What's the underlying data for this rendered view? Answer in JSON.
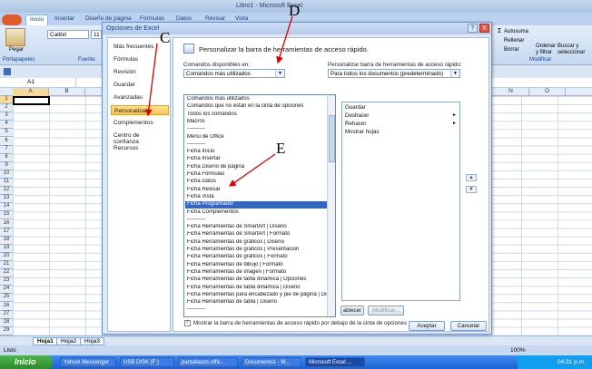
{
  "window": {
    "title": "Libro1 - Microsoft Excel"
  },
  "ribbon": {
    "tabs": [
      "Inicio",
      "Insertar",
      "Diseño de página",
      "Fórmulas",
      "Datos",
      "Revisar",
      "Vista"
    ],
    "paste_label": "Pegar",
    "clipboard_label": "Portapapeles",
    "font_label": "Fuente",
    "font_name": "Calibri",
    "font_size": "11",
    "modify_label": "Modificar",
    "autosum_label": "Autosuma",
    "fill_label": "Rellenar",
    "clear_label": "Borrar",
    "sort_label": "Ordenar y filtrar",
    "find_label": "Buscar y seleccionar"
  },
  "namebox": "A1",
  "grid": {
    "columns": [
      "A",
      "B",
      "N",
      "O"
    ],
    "rows": [
      "1",
      "2",
      "3",
      "4",
      "5",
      "6",
      "7",
      "8",
      "9",
      "10",
      "11",
      "12",
      "13",
      "14",
      "15",
      "16",
      "17",
      "18",
      "19",
      "20",
      "21",
      "22",
      "23",
      "24",
      "25",
      "26",
      "27",
      "28",
      "29"
    ]
  },
  "sheets": [
    "Hoja1",
    "Hoja2",
    "Hoja3"
  ],
  "status": {
    "left": "Listo",
    "zoom": "100%"
  },
  "taskbar": {
    "start": "Inicio",
    "items": [
      "Yahoo! Messenger",
      "USB DISK (F:)",
      "pantallazos offic...",
      "Documento1 - M...",
      "Microsoft Excel ..."
    ],
    "clock": "04:31 p.m."
  },
  "dialog": {
    "title": "Opciones de Excel",
    "help": "?",
    "close": "X",
    "nav": [
      "Más frecuentes",
      "Fórmulas",
      "Revisión",
      "Guardar",
      "Avanzadas",
      "Personalizar",
      "Complementos",
      "Centro de confianza",
      "Recursos"
    ],
    "nav_active_index": 5,
    "heading": "Personalizar la barra de herramientas de acceso rápido.",
    "commands_label": "Comandos disponibles en:",
    "commands_value": "Comandos más utilizados",
    "customize_label": "Personalizar barra de herramientas de acceso rápido:",
    "customize_value": "Para todos los documentos (predeterminado)",
    "dropdown_options": [
      "Comandos más utilizados",
      "Comandos que no están en la cinta de opciones",
      "Todos los comandos",
      "Macros",
      "----------",
      "Menú de Office",
      "----------",
      "Ficha Inicio",
      "Ficha Insertar",
      "Ficha Diseño de página",
      "Ficha Fórmulas",
      "Ficha Datos",
      "Ficha Revisar",
      "Ficha Vista",
      "Ficha Programador",
      "Ficha Complementos",
      "----------",
      "Ficha Herramientas de SmartArt | Diseño",
      "Ficha Herramientas de SmartArt | Formato",
      "Ficha Herramientas de gráficos | Diseño",
      "Ficha Herramientas de gráficos | Presentación",
      "Ficha Herramientas de gráficos | Formato",
      "Ficha Herramientas de dibujo | Formato",
      "Ficha Herramientas de imagen | Formato",
      "Ficha Herramientas de tabla dinámica | Opciones",
      "Ficha Herramientas de tabla dinámica | Diseño",
      "Ficha Herramientas para encabezado y pie de página | Diseño",
      "Ficha Herramientas de tabla | Diseño",
      "----------"
    ],
    "dropdown_selected_index": 14,
    "right_items": [
      "Guardar",
      "Deshacer",
      "Rehacer",
      "Mostrar hojas"
    ],
    "reset_label": "ablecer",
    "modify_label": "Modificar...",
    "show_below_label": "Mostrar la barra de herramientas de acceso rápido por debajo de la cinta de opciones",
    "ok_label": "Aceptar",
    "cancel_label": "Cancelar"
  },
  "annotations": {
    "c": "C",
    "d": "D",
    "e": "E"
  }
}
